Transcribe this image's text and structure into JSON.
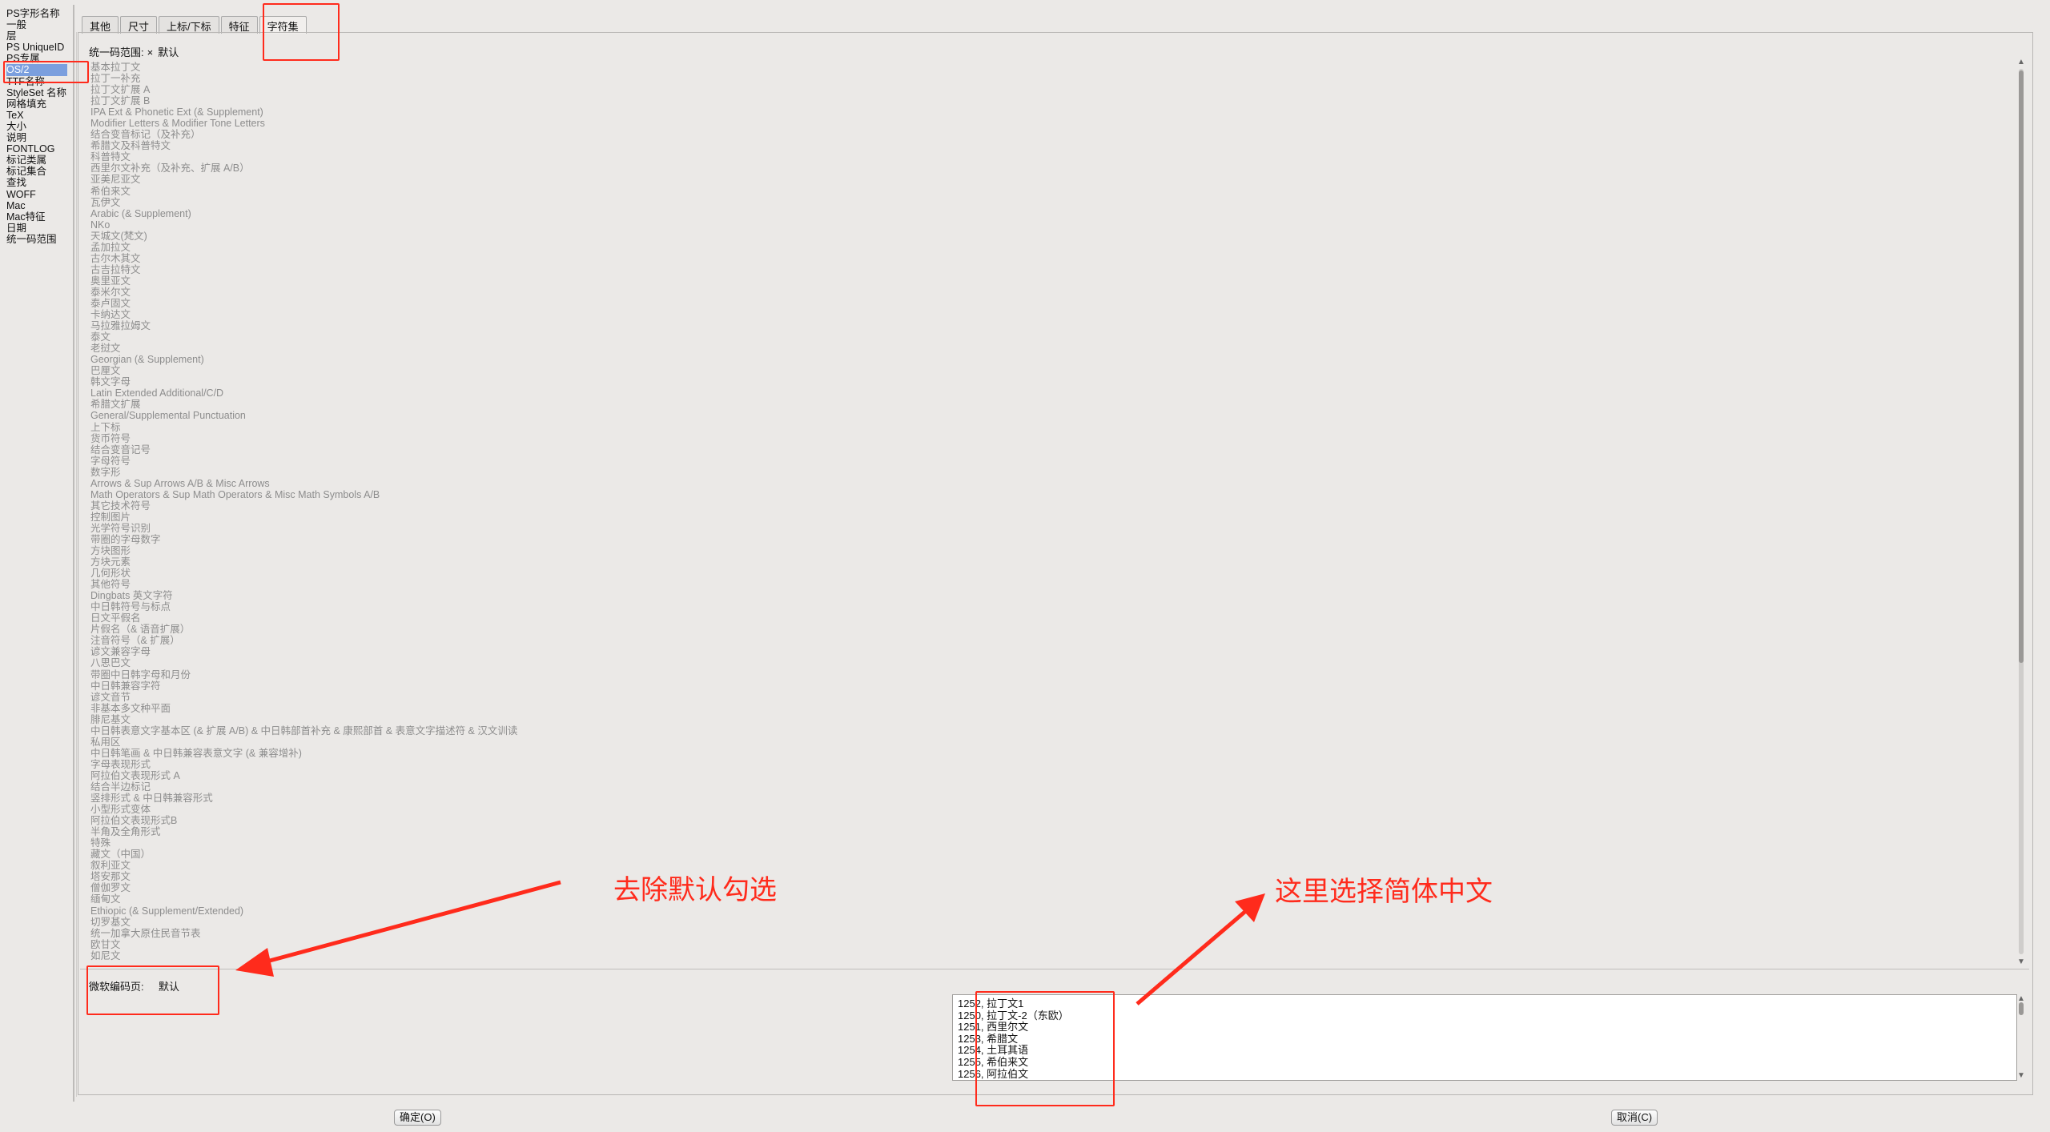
{
  "sidebar": {
    "items": [
      "PS字形名称",
      "一般",
      "层",
      "PS UniqueID",
      "PS专属",
      "OS/2",
      "TTF名称",
      "StyleSet 名称",
      "网格填充",
      "TeX",
      "大小",
      "说明",
      "FONTLOG",
      "标记类属",
      "标记集合",
      "查找",
      "WOFF",
      "Mac",
      "Mac特征",
      "日期",
      "统一码范围"
    ],
    "selected_index": 5
  },
  "tabs": [
    "其他",
    "尺寸",
    "上标/下标",
    "特征",
    "字符集"
  ],
  "active_tab": "字符集",
  "unicode_range": {
    "label": "统一码范围:",
    "clear_icon": "×",
    "value": "默认"
  },
  "unicode_ranges": [
    "基本拉丁文",
    "拉丁一补充",
    "拉丁文扩展 A",
    "拉丁文扩展 B",
    "IPA Ext & Phonetic Ext (& Supplement)",
    "Modifier Letters & Modifier Tone Letters",
    "结合变音标记（及补充）",
    "希腊文及科普特文",
    "科普特文",
    "西里尔文补充（及补充、扩展 A/B）",
    "亚美尼亚文",
    "希伯来文",
    "瓦伊文",
    "Arabic (& Supplement)",
    "NKo",
    "天城文(梵文)",
    "孟加拉文",
    "古尔木其文",
    "古吉拉特文",
    "奥里亚文",
    "泰米尔文",
    "泰卢固文",
    "卡纳达文",
    "马拉雅拉姆文",
    "泰文",
    "老挝文",
    "Georgian (& Supplement)",
    "巴厘文",
    "韩文字母",
    "Latin Extended Additional/C/D",
    "希腊文扩展",
    "General/Supplemental Punctuation",
    "上下标",
    "货币符号",
    "结合变音记号",
    "字母符号",
    "数字形",
    "Arrows & Sup Arrows A/B & Misc Arrows",
    "Math Operators & Sup Math Operators & Misc Math Symbols A/B",
    "其它技术符号",
    "控制图片",
    "光学符号识别",
    "带圈的字母数字",
    "方块图形",
    "方块元素",
    "几何形状",
    "其他符号",
    "Dingbats 英文字符",
    "中日韩符号与标点",
    "日文平假名",
    "片假名（& 语音扩展）",
    "注音符号（& 扩展）",
    "谚文兼容字母",
    "八思巴文",
    "带圈中日韩字母和月份",
    "中日韩兼容字符",
    "谚文音节",
    "非基本多文种平面",
    "腓尼基文",
    "中日韩表意文字基本区 (& 扩展 A/B) & 中日韩部首补充 & 康熙部首 & 表意文字描述符 & 汉文训读",
    "私用区",
    "中日韩笔画 & 中日韩兼容表意文字 (& 兼容增补)",
    "字母表现形式",
    "阿拉伯文表现形式 A",
    "结合半边标记",
    "竖排形式 & 中日韩兼容形式",
    "小型形式变体",
    "阿拉伯文表现形式B",
    "半角及全角形式",
    "特殊",
    "藏文（中国）",
    "叙利亚文",
    "塔安那文",
    "僧伽罗文",
    "缅甸文",
    "Ethiopic (& Supplement/Extended)",
    "切罗基文",
    "统一加拿大原住民音节表",
    "欧甘文",
    "如尼文"
  ],
  "codepage": {
    "label": "微软编码页:",
    "value": "默认"
  },
  "codepages": [
    "1252, 拉丁文1",
    "1250, 拉丁文-2（东欧）",
    "1251, 西里尔文",
    "1253, 希腊文",
    "1254, 土耳其语",
    "1255, 希伯来文",
    "1256, 阿拉伯文"
  ],
  "buttons": {
    "ok": "确定(O)",
    "cancel": "取消(C)"
  },
  "annotations": {
    "left": "去除默认勾选",
    "right": "这里选择简体中文",
    "color": "#ff2b1c"
  }
}
